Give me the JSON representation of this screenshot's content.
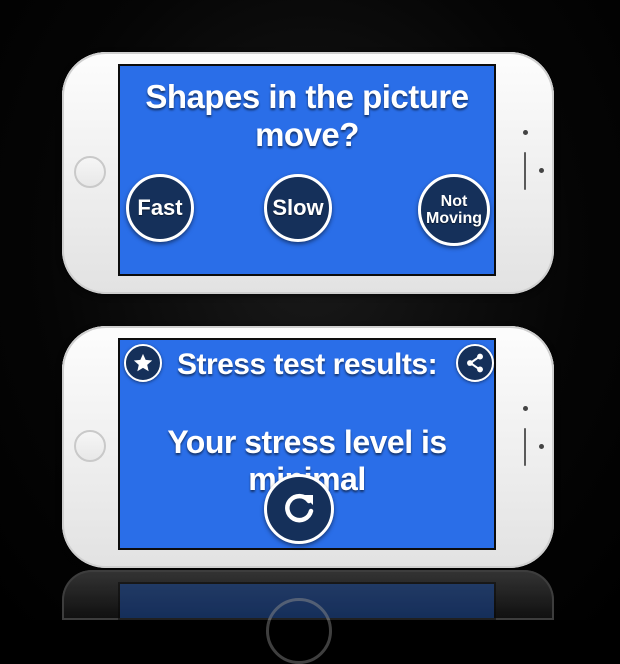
{
  "question_screen": {
    "title": "Shapes in the picture move?",
    "options": [
      {
        "label": "Fast"
      },
      {
        "label": "Slow"
      },
      {
        "label_line1": "Not",
        "label_line2": "Moving"
      }
    ]
  },
  "results_screen": {
    "title": "Stress test results:",
    "result_text": "Your stress level is minimal",
    "favorite_icon": "star-icon",
    "share_icon": "share-icon",
    "restart_icon": "refresh-icon"
  },
  "colors": {
    "screen_blue": "#2a6ee8",
    "button_navy": "#15305a",
    "text_white": "#ffffff"
  }
}
